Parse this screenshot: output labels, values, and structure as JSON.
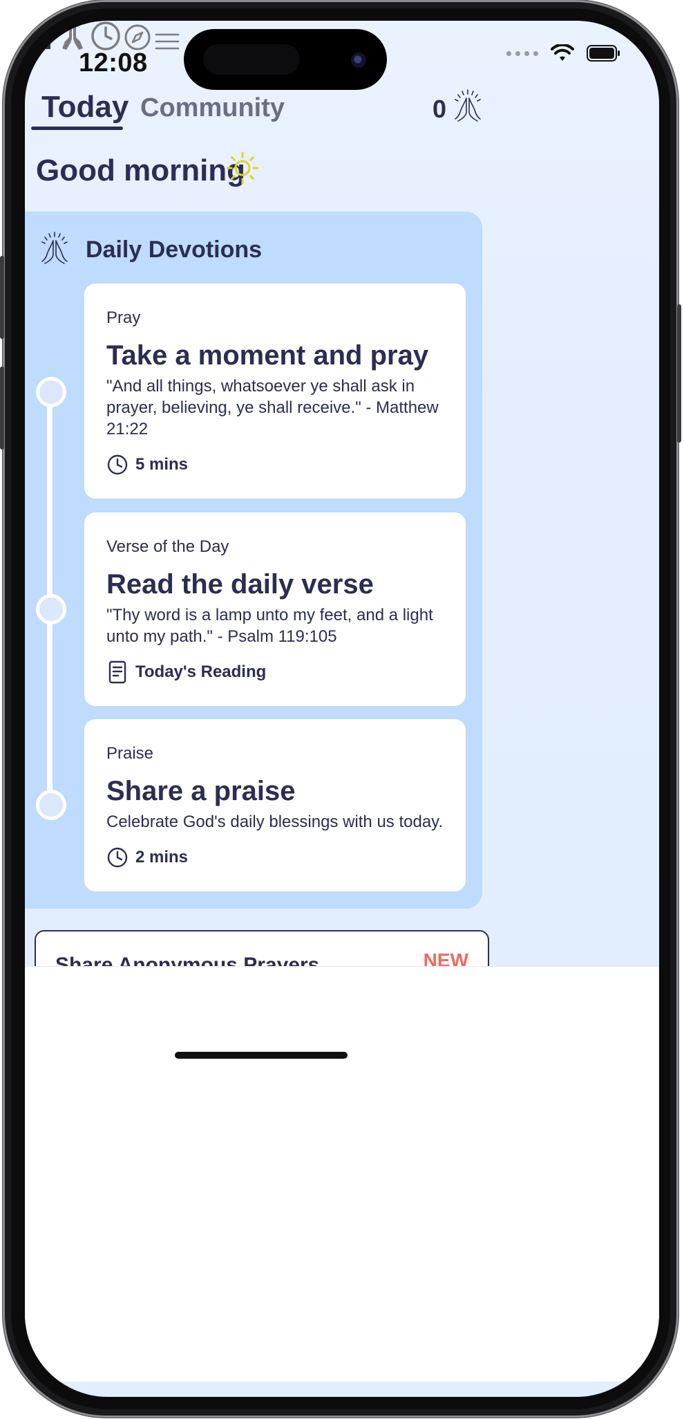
{
  "status_bar": {
    "time": "12:08"
  },
  "header": {
    "tabs": [
      {
        "label": "Today",
        "active": true
      },
      {
        "label": "Community",
        "active": false
      }
    ],
    "prayer_count": "0"
  },
  "greeting": {
    "text": "Good morning",
    "icon": "sun-icon"
  },
  "devotions": {
    "title": "Daily Devotions",
    "cards": [
      {
        "kicker": "Pray",
        "title": "Take a moment and pray",
        "description": "\"And all things, whatsoever ye shall ask in prayer, believing, ye shall receive.\" - Matthew 21:22",
        "meta_icon": "clock-icon",
        "meta_label": "5 mins"
      },
      {
        "kicker": "Verse of the Day",
        "title": "Read the daily verse",
        "description": "\"Thy word is a lamp unto my feet, and a light unto my path.\" - Psalm 119:105",
        "meta_icon": "document-icon",
        "meta_label": "Today's Reading"
      },
      {
        "kicker": "Praise",
        "title": "Share a praise",
        "description": "Celebrate God's daily blessings with us today.",
        "meta_icon": "clock-icon",
        "meta_label": "2 mins"
      }
    ]
  },
  "share_card": {
    "title": "Share Anonymous Prayers",
    "badge": "NEW"
  },
  "tabbar": {
    "items": [
      {
        "icon": "home-icon",
        "active": true
      },
      {
        "icon": "praying-hands-icon",
        "active": false
      },
      {
        "icon": "clock-icon",
        "active": false
      },
      {
        "icon": "compass-icon",
        "active": false
      },
      {
        "icon": "menu-icon",
        "active": false
      }
    ]
  },
  "colors": {
    "text_primary": "#2b2d52",
    "panel_bg": "#bfdbfd",
    "screen_bg": "#eaf2fe",
    "sun": "#e0d424",
    "new_badge": "#ee6a63",
    "inactive_icon": "#7c7c80"
  }
}
